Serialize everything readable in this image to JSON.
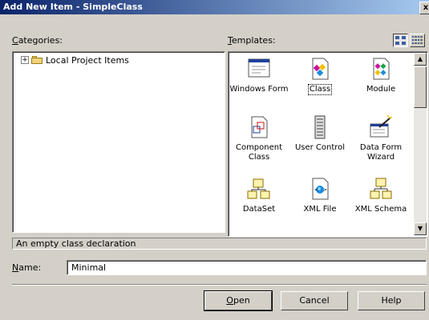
{
  "window": {
    "title": "Add New Item - SimpleClass",
    "close_glyph": "x"
  },
  "categories": {
    "label": "Categories:",
    "items": [
      {
        "label": "Local Project Items",
        "expander": "+"
      }
    ]
  },
  "templates": {
    "label": "Templates:",
    "items": [
      {
        "label": "Windows Form",
        "icon": "windows-form-icon"
      },
      {
        "label": "Class",
        "icon": "class-icon",
        "selected": true
      },
      {
        "label": "Module",
        "icon": "module-icon"
      },
      {
        "label": "Component\nClass",
        "icon": "component-class-icon"
      },
      {
        "label": "User Control",
        "icon": "user-control-icon"
      },
      {
        "label": "Data Form\nWizard",
        "icon": "data-form-wizard-icon"
      },
      {
        "label": "DataSet",
        "icon": "dataset-icon"
      },
      {
        "label": "XML File",
        "icon": "xml-file-icon"
      },
      {
        "label": "XML Schema",
        "icon": "xml-schema-icon"
      }
    ]
  },
  "description": "An empty class declaration",
  "name_field": {
    "label": "Name:",
    "value": "Minimal"
  },
  "buttons": {
    "open": "Open",
    "cancel": "Cancel",
    "help": "Help"
  },
  "scrollbar": {
    "up_glyph": "▲",
    "down_glyph": "▼"
  }
}
